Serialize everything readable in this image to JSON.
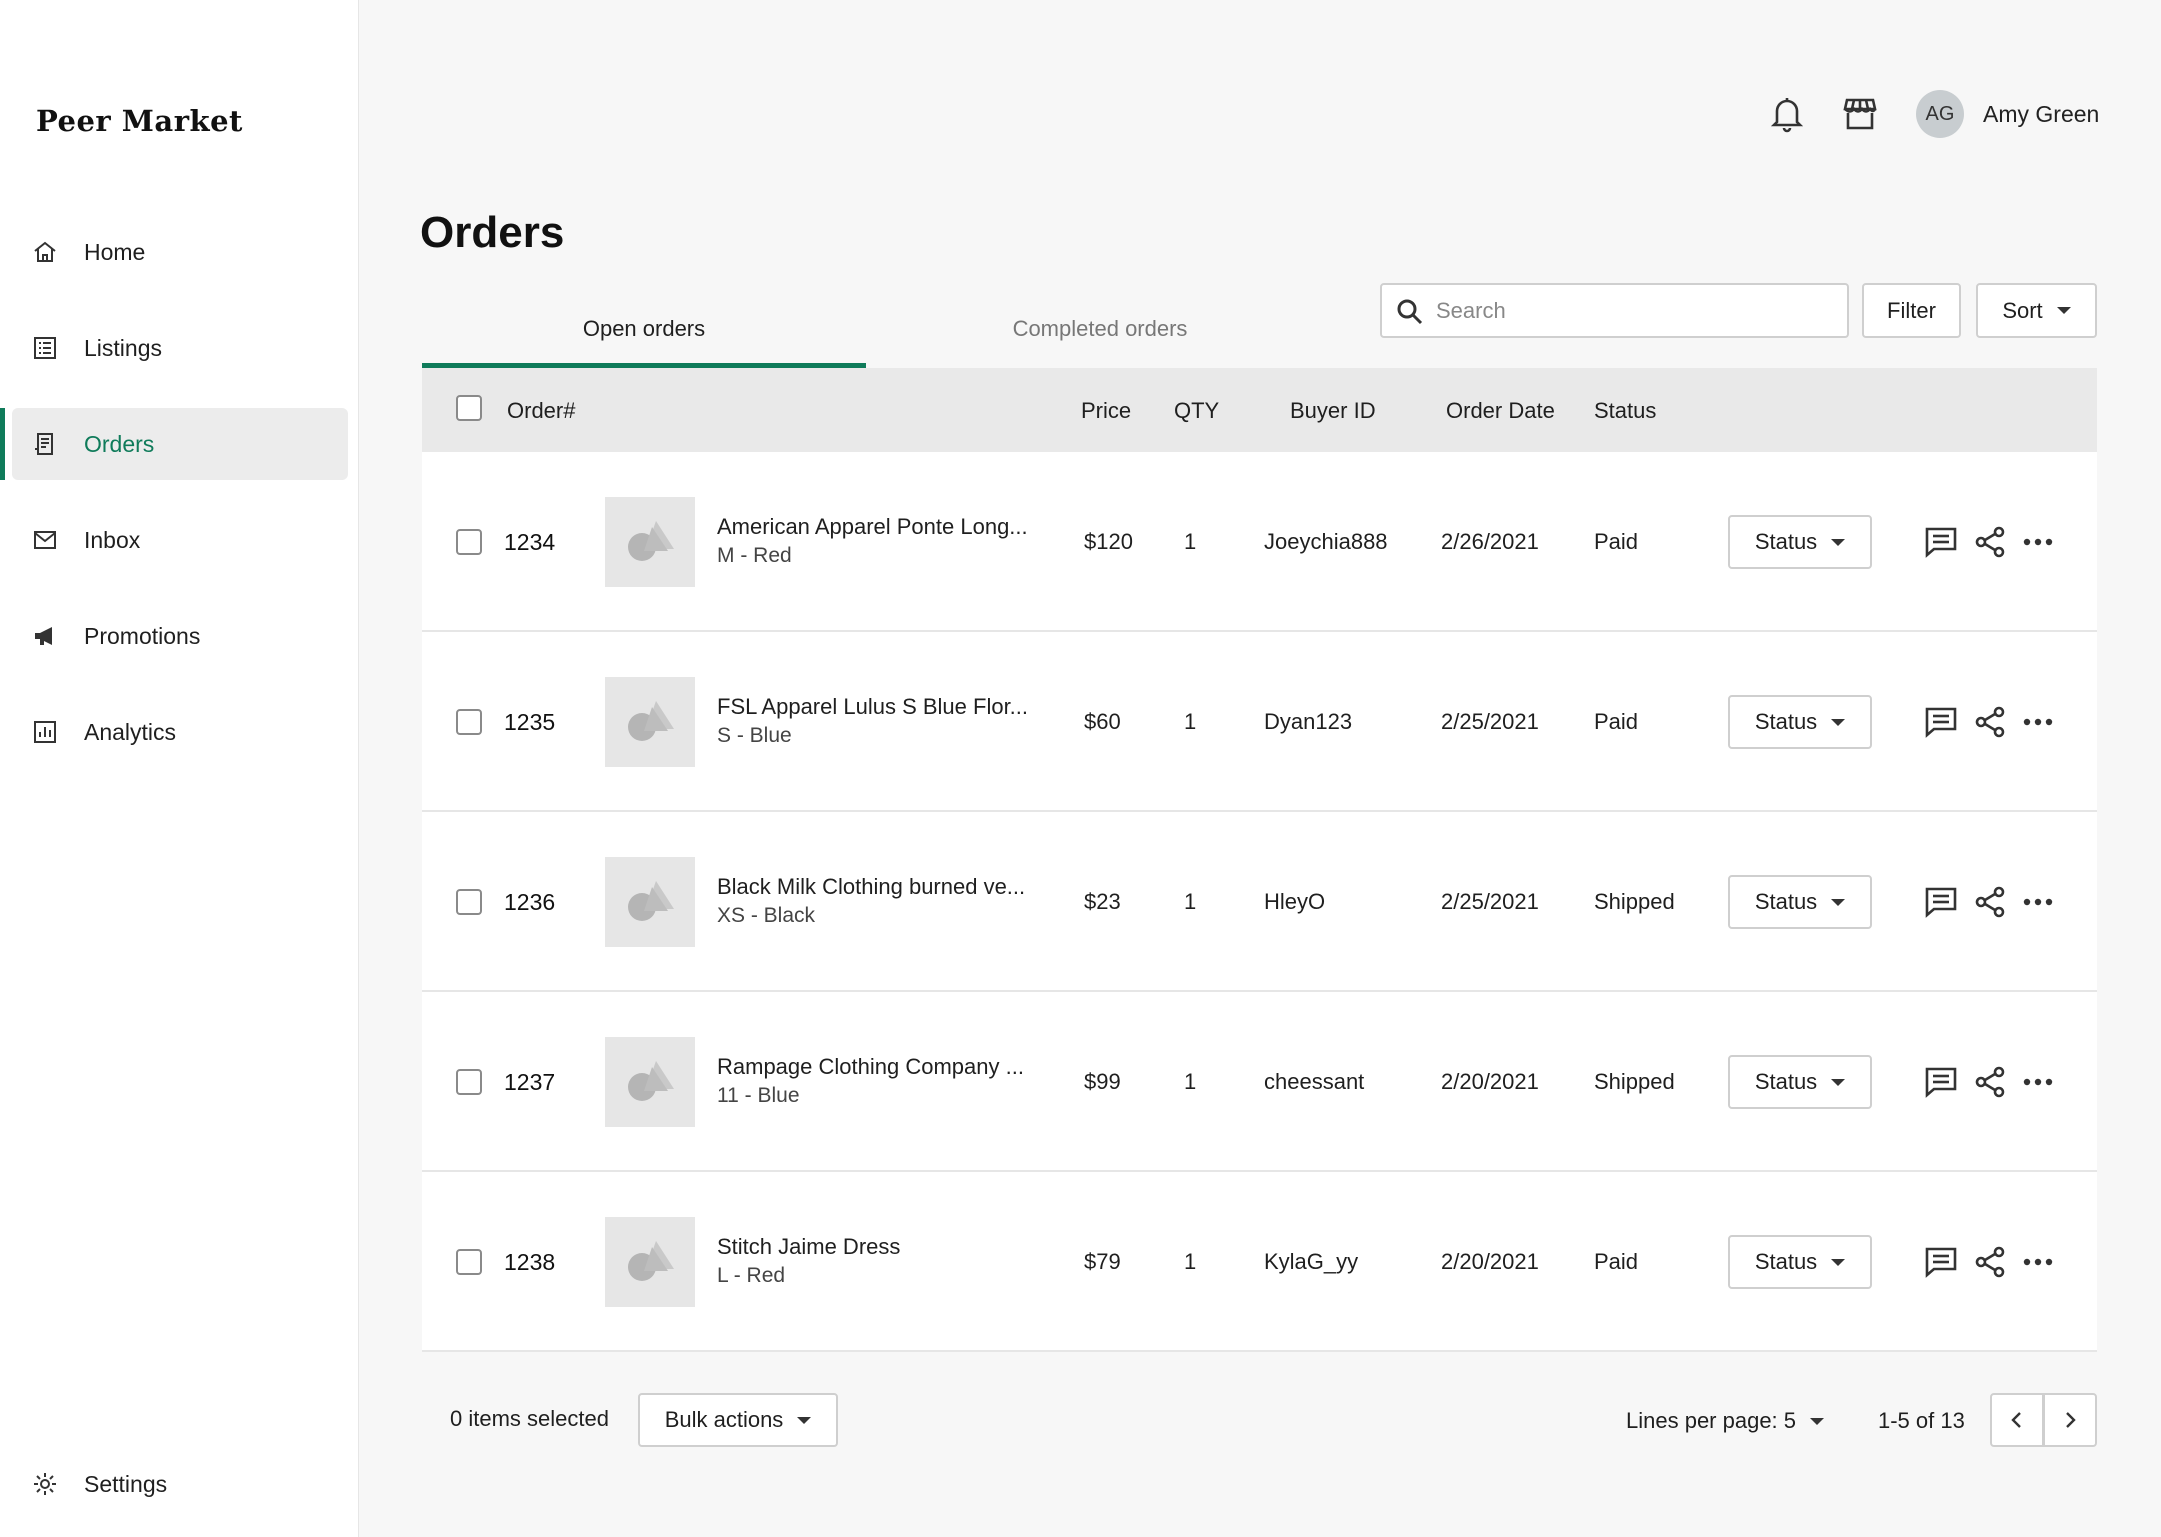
{
  "app": {
    "logo": "Peer Market"
  },
  "sidebar": {
    "items": [
      {
        "label": "Home",
        "icon": "home-icon"
      },
      {
        "label": "Listings",
        "icon": "listings-icon"
      },
      {
        "label": "Orders",
        "icon": "orders-icon",
        "active": true
      },
      {
        "label": "Inbox",
        "icon": "mail-icon"
      },
      {
        "label": "Promotions",
        "icon": "megaphone-icon"
      },
      {
        "label": "Analytics",
        "icon": "analytics-icon"
      }
    ],
    "settings": {
      "label": "Settings",
      "icon": "gear-icon"
    }
  },
  "header": {
    "user_initials": "AG",
    "user_name": "Amy Green"
  },
  "page": {
    "title": "Orders"
  },
  "tabs": [
    {
      "label": "Open orders",
      "active": true
    },
    {
      "label": "Completed orders",
      "active": false
    }
  ],
  "toolbar": {
    "search_placeholder": "Search",
    "filter_label": "Filter",
    "sort_label": "Sort"
  },
  "table": {
    "columns": [
      "Order#",
      "Price",
      "QTY",
      "Buyer ID",
      "Order Date",
      "Status"
    ],
    "status_button_label": "Status",
    "rows": [
      {
        "order": "1234",
        "name": "American Apparel Ponte Long...",
        "variant": "M - Red",
        "price": "$120",
        "qty": "1",
        "buyer": "Joeychia888",
        "date": "2/26/2021",
        "status": "Paid"
      },
      {
        "order": "1235",
        "name": "FSL Apparel Lulus S Blue Flor...",
        "variant": "S - Blue",
        "price": "$60",
        "qty": "1",
        "buyer": "Dyan123",
        "date": "2/25/2021",
        "status": "Paid"
      },
      {
        "order": "1236",
        "name": "Black Milk Clothing burned ve...",
        "variant": "XS - Black",
        "price": "$23",
        "qty": "1",
        "buyer": "HleyO",
        "date": "2/25/2021",
        "status": "Shipped"
      },
      {
        "order": "1237",
        "name": "Rampage Clothing Company ...",
        "variant": "11 - Blue",
        "price": "$99",
        "qty": "1",
        "buyer": "cheessant",
        "date": "2/20/2021",
        "status": "Shipped"
      },
      {
        "order": "1238",
        "name": "Stitch Jaime Dress",
        "variant": "L - Red",
        "price": "$79",
        "qty": "1",
        "buyer": "KylaG_yy",
        "date": "2/20/2021",
        "status": "Paid"
      }
    ]
  },
  "footer": {
    "selected_text": "0 items selected",
    "bulk_actions_label": "Bulk actions",
    "lines_per_page": "Lines per page: 5",
    "range_text": "1-5 of 13"
  },
  "colors": {
    "accent": "#0f7b5a",
    "header_bg": "#e9e9e9",
    "page_bg": "#f7f7f7"
  }
}
